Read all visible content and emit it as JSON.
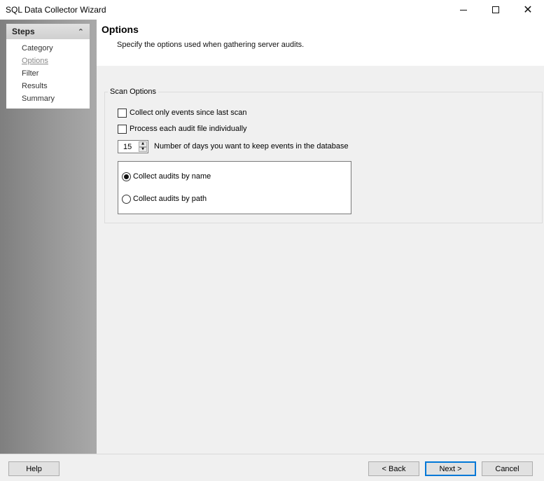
{
  "window": {
    "title": "SQL Data Collector Wizard"
  },
  "steps": {
    "header": "Steps",
    "items": [
      {
        "label": "Category",
        "current": false
      },
      {
        "label": "Options",
        "current": true
      },
      {
        "label": "Filter",
        "current": false
      },
      {
        "label": "Results",
        "current": false
      },
      {
        "label": "Summary",
        "current": false
      }
    ]
  },
  "page": {
    "title": "Options",
    "subtitle": "Specify the options used when gathering server audits."
  },
  "scan_options": {
    "legend": "Scan Options",
    "collect_since_last_scan": {
      "label": "Collect only events since last scan",
      "checked": false
    },
    "process_individually": {
      "label": "Process each audit file individually",
      "checked": false
    },
    "days_value": "15",
    "days_label": "Number of days you want to keep events in the database",
    "collect_by_name": {
      "label": "Collect audits by name",
      "selected": true
    },
    "collect_by_path": {
      "label": "Collect audits by path",
      "selected": false
    }
  },
  "buttons": {
    "help": "Help",
    "back": "< Back",
    "next": "Next >",
    "cancel": "Cancel"
  },
  "icons": {
    "minimize": "minimize-icon",
    "maximize": "maximize-icon",
    "close": "close-icon",
    "collapse": "double-chevron-up-icon"
  }
}
